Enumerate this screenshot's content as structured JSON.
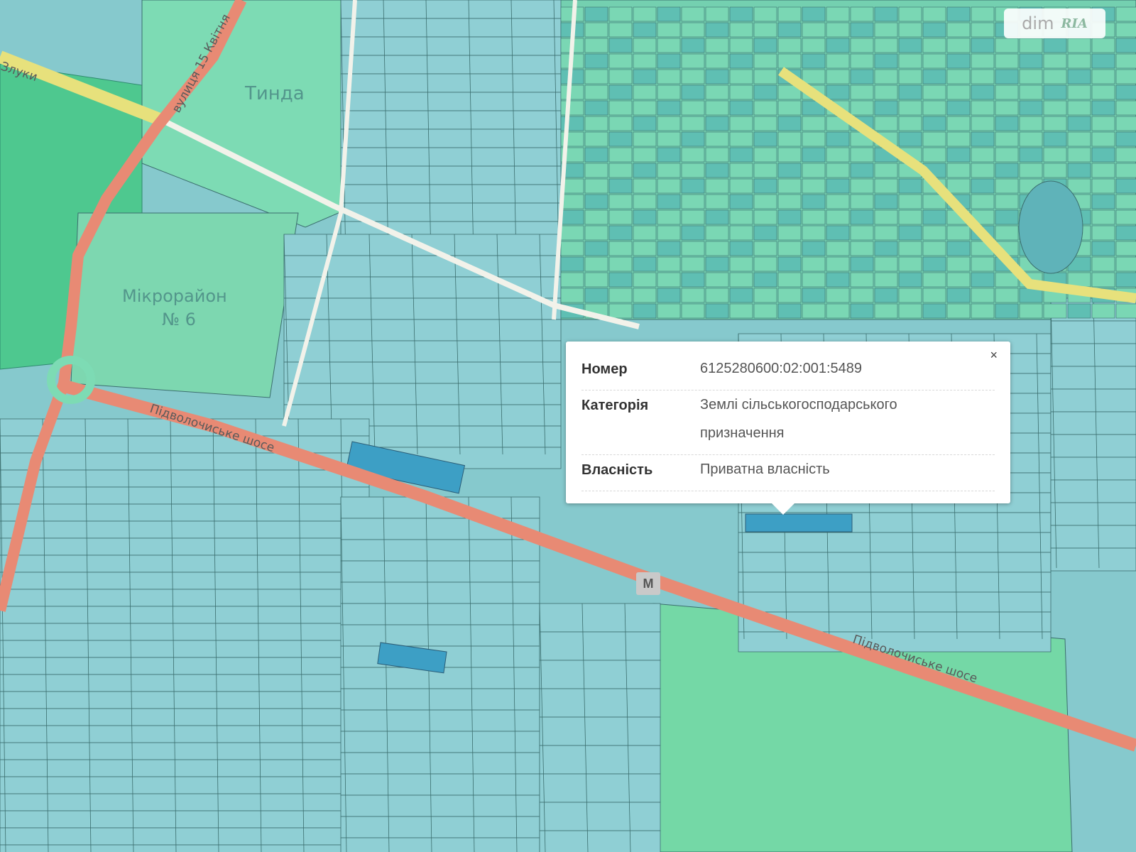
{
  "map": {
    "colors": {
      "parcel_fill": "#8fcfd4",
      "parcel_stroke": "#3b6e6e",
      "residential_fill": "#6fd3aa",
      "highlight_fill": "#3d9fc5",
      "road_main": "#e88a74",
      "road_minor": "#f2f2ea",
      "park_fill": "#4ec88f",
      "yellow_road": "#e7e17c"
    },
    "labels": {
      "district_tynda": "Тинда",
      "district_micro_1": "Мікрорайон",
      "district_micro_2": "№ 6",
      "street_15_kvitnia": "вулиця 15 Квітня",
      "street_zluky": "Злуки",
      "street_pidvolochyske": "Підволочиське шосе",
      "street_pidvolochyske_2": "Підволочиське шосе"
    },
    "metro_label": "M"
  },
  "popup": {
    "close_icon": "×",
    "rows": [
      {
        "key": "Номер",
        "value": "6125280600:02:001:5489"
      },
      {
        "key": "Категорія",
        "value": "Землі сільськогосподарського призначення"
      },
      {
        "key": "Власність",
        "value": "Приватна власність"
      }
    ]
  },
  "watermark": {
    "text": "dim",
    "brand": "RIA"
  }
}
